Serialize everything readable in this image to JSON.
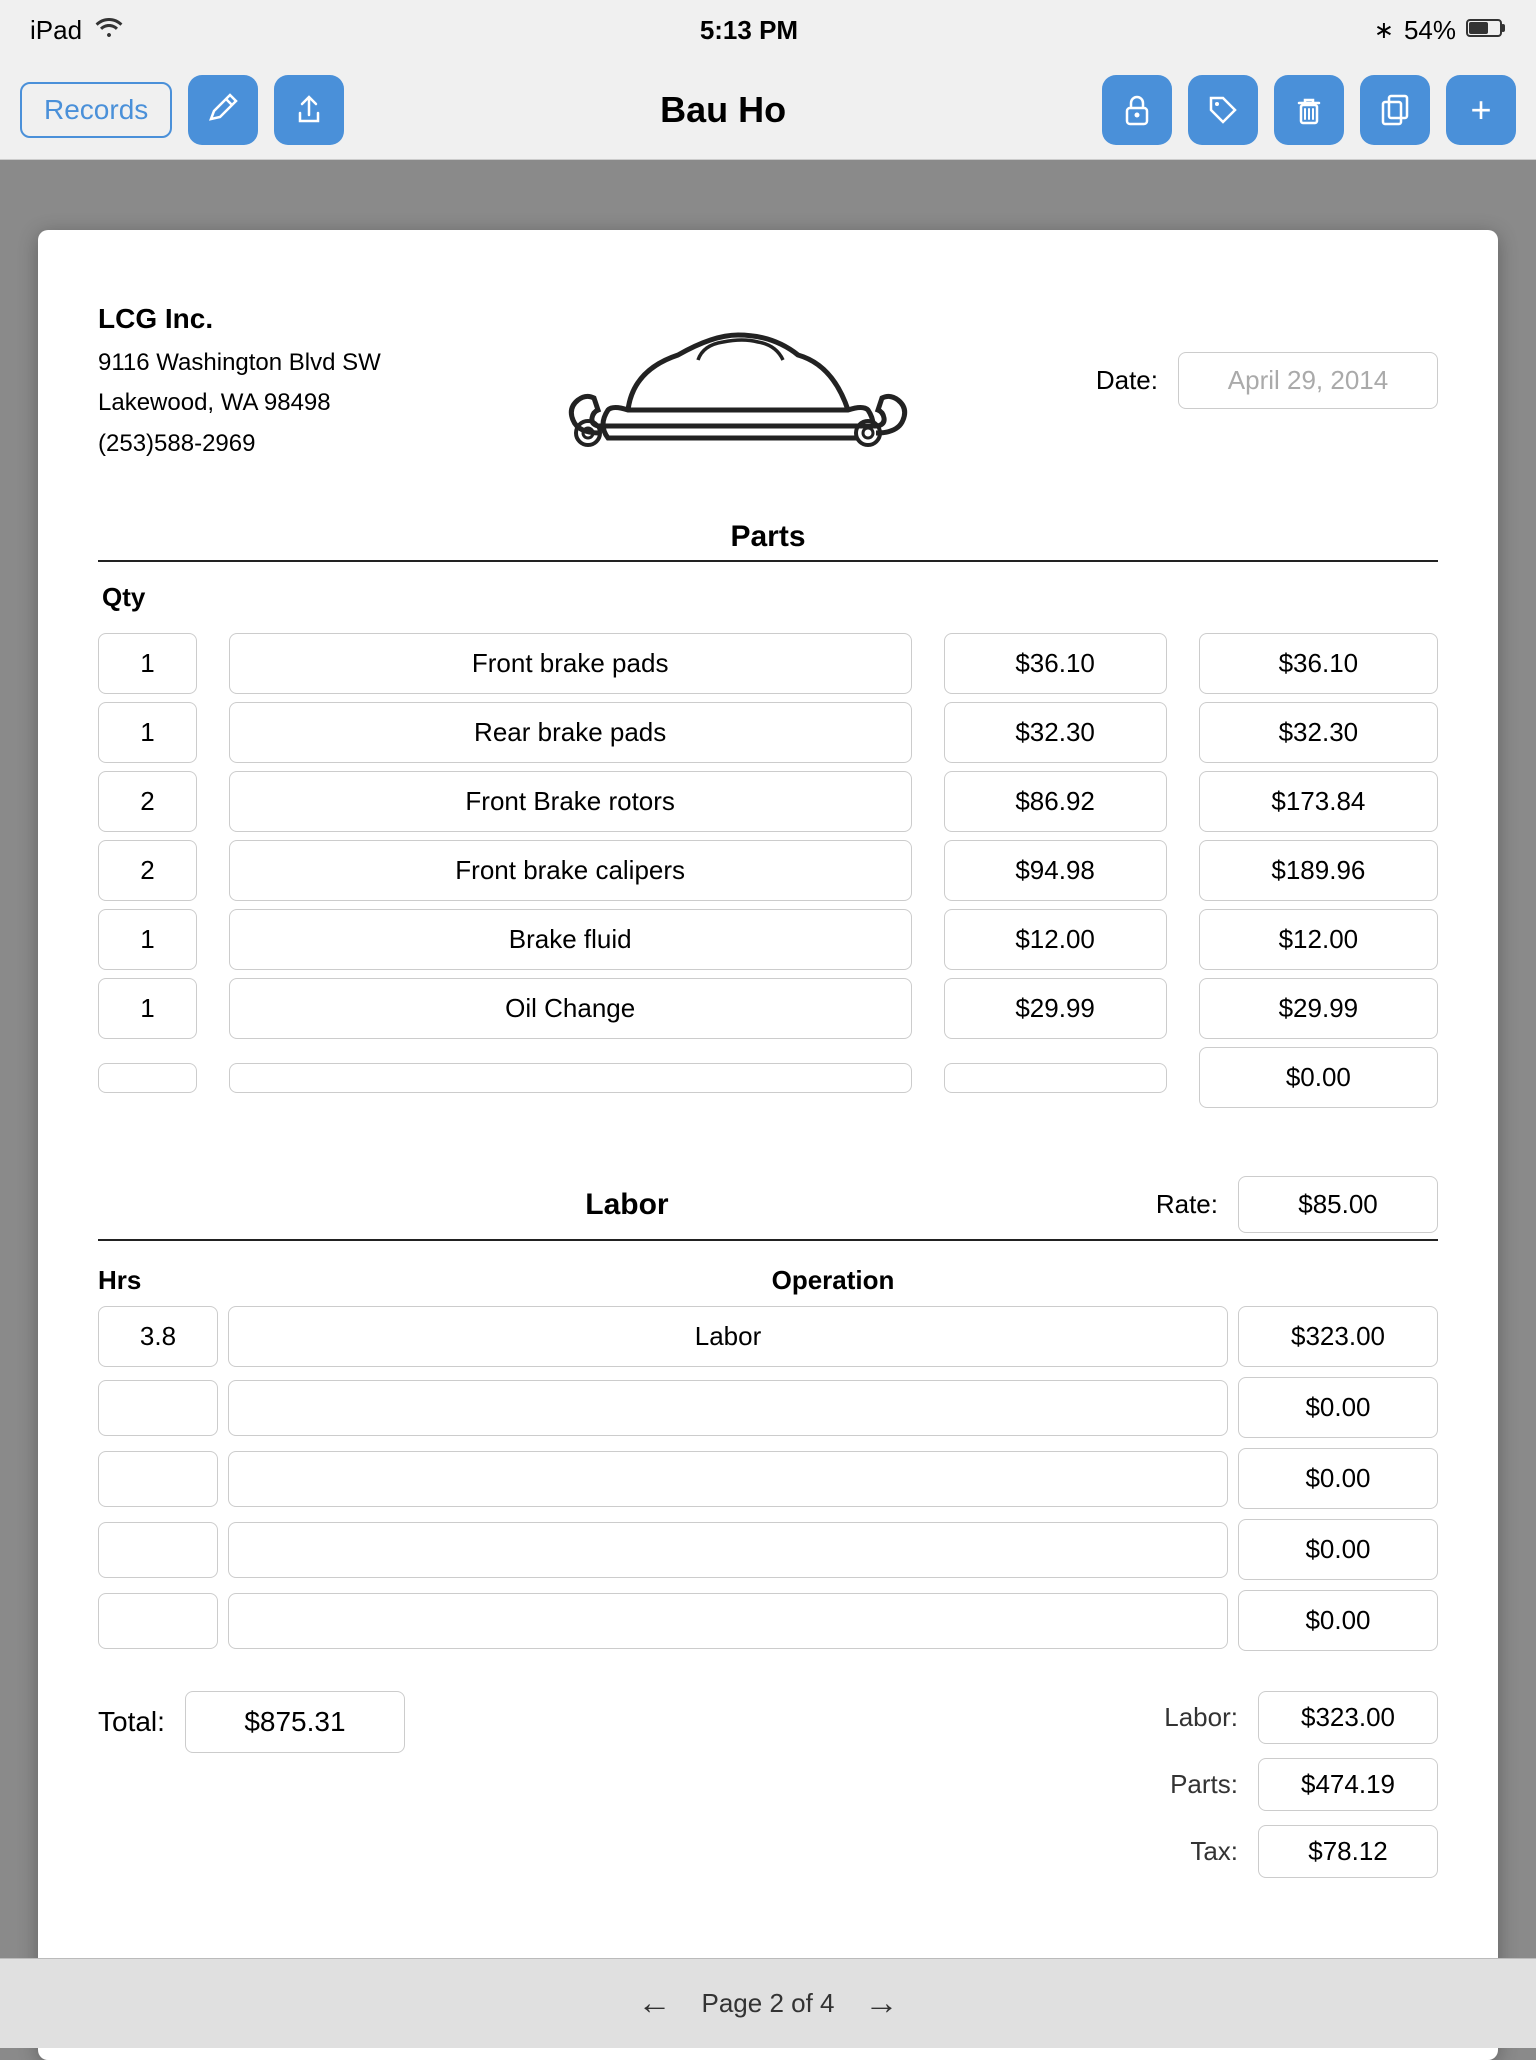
{
  "status_bar": {
    "device": "iPad",
    "wifi_icon": "wifi",
    "time": "5:13 PM",
    "bluetooth_icon": "bluetooth",
    "battery": "54%",
    "battery_icon": "battery"
  },
  "nav_bar": {
    "records_label": "Records",
    "title": "Bau Ho",
    "icons": {
      "pen": "✏️",
      "share": "↑",
      "lock": "🔒",
      "tag": "🏷",
      "trash": "🗑",
      "copy": "📋",
      "add": "+"
    }
  },
  "document": {
    "company": {
      "name": "LCG Inc.",
      "address1": "9116 Washington Blvd SW",
      "address2": "Lakewood, WA  98498",
      "phone": "(253)588-2969"
    },
    "date_label": "Date:",
    "date_value": "April 29, 2014",
    "parts_section_title": "Parts",
    "qty_header": "Qty",
    "parts": [
      {
        "qty": "1",
        "desc": "Front brake pads",
        "unit_price": "$36.10",
        "total": "$36.10"
      },
      {
        "qty": "1",
        "desc": "Rear brake pads",
        "unit_price": "$32.30",
        "total": "$32.30"
      },
      {
        "qty": "2",
        "desc": "Front Brake rotors",
        "unit_price": "$86.92",
        "total": "$173.84"
      },
      {
        "qty": "2",
        "desc": "Front brake calipers",
        "unit_price": "$94.98",
        "total": "$189.96"
      },
      {
        "qty": "1",
        "desc": "Brake fluid",
        "unit_price": "$12.00",
        "total": "$12.00"
      },
      {
        "qty": "1",
        "desc": "Oil Change",
        "unit_price": "$29.99",
        "total": "$29.99"
      },
      {
        "qty": "",
        "desc": "",
        "unit_price": "",
        "total": "$0.00"
      }
    ],
    "labor_section_title": "Labor",
    "rate_label": "Rate:",
    "rate_value": "$85.00",
    "hrs_header": "Hrs",
    "operation_header": "Operation",
    "labor_rows": [
      {
        "hrs": "3.8",
        "operation": "Labor",
        "total": "$323.00"
      },
      {
        "hrs": "",
        "operation": "",
        "total": "$0.00"
      },
      {
        "hrs": "",
        "operation": "",
        "total": "$0.00"
      },
      {
        "hrs": "",
        "operation": "",
        "total": "$0.00"
      },
      {
        "hrs": "",
        "operation": "",
        "total": "$0.00"
      }
    ],
    "summary": {
      "total_label": "Total:",
      "total_value": "$875.31",
      "labor_label": "Labor:",
      "labor_value": "$323.00",
      "parts_label": "Parts:",
      "parts_value": "$474.19",
      "tax_label": "Tax:",
      "tax_value": "$78.12"
    }
  },
  "pagination": {
    "label": "Page 2 of 4"
  }
}
